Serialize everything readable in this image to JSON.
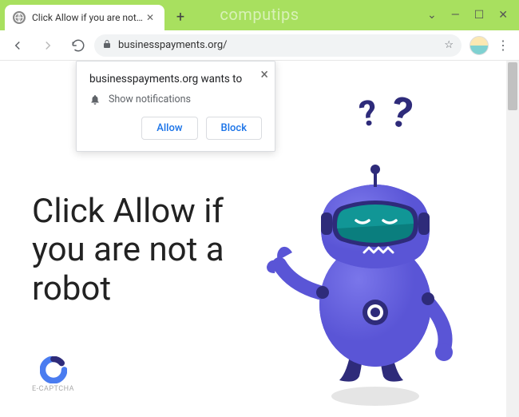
{
  "window": {
    "watermark": "computips",
    "tab": {
      "title": "Click Allow if you are not a robot"
    },
    "url": "businesspayments.org/"
  },
  "permission": {
    "site_wants_to": "businesspayments.org wants to",
    "notification_label": "Show notifications",
    "allow": "Allow",
    "block": "Block"
  },
  "page": {
    "hero_line1": "Click Allow if",
    "hero_line2": "you are not a",
    "hero_line3": "robot",
    "captcha_label": "E-CAPTCHA",
    "question_marks": "??"
  },
  "colors": {
    "accent_green": "#a8e05f",
    "link_blue": "#1a73e8",
    "robot_primary": "#5a55d6",
    "robot_dark": "#2e2b7a",
    "visor": "#0a7e7e"
  }
}
